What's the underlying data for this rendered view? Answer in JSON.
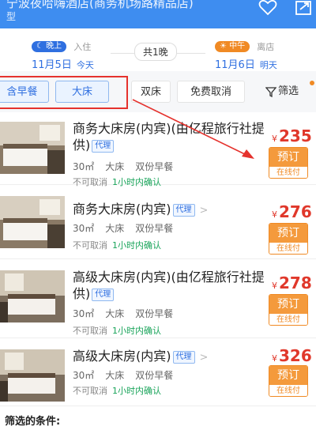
{
  "header": {
    "title": "宁波夜哈嗨酒店(商务机场路精品店)",
    "subtitle": "型",
    "colors": {
      "bar": "#3e8df0"
    },
    "icons": [
      "heart-icon",
      "share-icon"
    ]
  },
  "dates": {
    "checkin": {
      "badge": "晚上",
      "label": "入住",
      "date": "11月5日",
      "day": "今天"
    },
    "nights": "共1晚",
    "checkout": {
      "badge": "中午",
      "label": "离店",
      "date": "11月6日",
      "day": "明天"
    }
  },
  "filters": {
    "chips": [
      "含早餐",
      "大床",
      "双床",
      "免费取消"
    ],
    "active": [
      "含早餐",
      "大床"
    ],
    "filter_label": "筛选"
  },
  "rooms": [
    {
      "name": "商务大床房(内宾)(由亿程旅行社提供)",
      "tag": "代理",
      "area": "30㎡",
      "bed": "大床",
      "breakfast": "双份早餐",
      "cancel": "不可取消",
      "confirm": "1小时内确认",
      "currency": "¥",
      "price": "235",
      "book": "预订",
      "pay": "在线付"
    },
    {
      "name": "商务大床房(内宾)",
      "tag": "代理",
      "area": "30㎡",
      "bed": "大床",
      "breakfast": "双份早餐",
      "cancel": "不可取消",
      "confirm": "1小时内确认",
      "currency": "¥",
      "price": "276",
      "book": "预订",
      "pay": "在线付"
    },
    {
      "name": "高级大床房(内宾)(由亿程旅行社提供)",
      "tag": "代理",
      "area": "30㎡",
      "bed": "大床",
      "breakfast": "双份早餐",
      "cancel": "不可取消",
      "confirm": "1小时内确认",
      "currency": "¥",
      "price": "278",
      "book": "预订",
      "pay": "在线付"
    },
    {
      "name": "高级大床房(内宾)",
      "tag": "代理",
      "area": "30㎡",
      "bed": "大床",
      "breakfast": "双份早餐",
      "cancel": "不可取消",
      "confirm": "1小时内确认",
      "currency": "¥",
      "price": "326",
      "book": "预订",
      "pay": "在线付"
    }
  ],
  "footer": {
    "criteria": "筛选的条件:"
  },
  "annotation": {
    "color": "#e5322d"
  }
}
